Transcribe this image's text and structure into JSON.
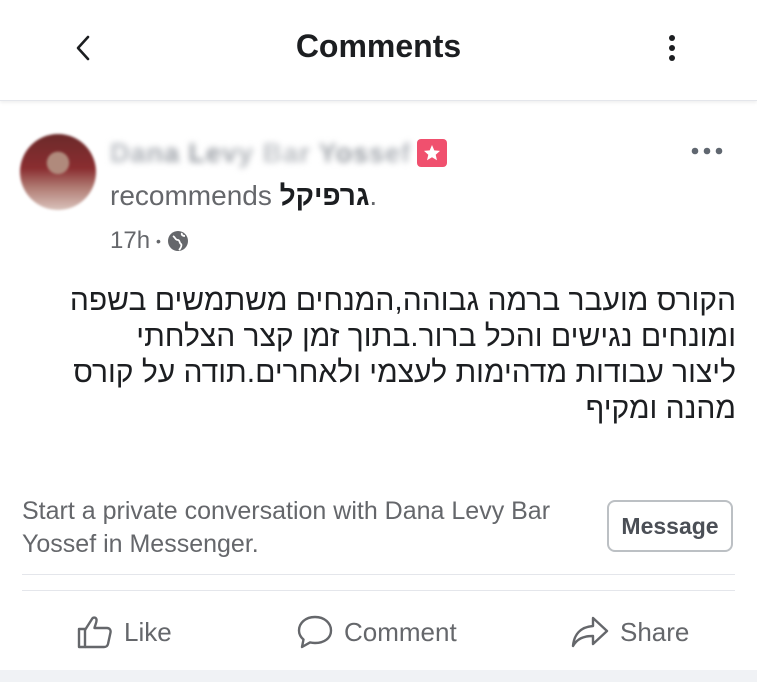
{
  "header": {
    "title": "Comments",
    "back_icon": "chevron-left-icon",
    "menu_icon": "kebab-vertical-icon"
  },
  "post": {
    "author_name": "Dana Levy Bar Yossef",
    "verb": "recommends",
    "page_name": "גרפיקל",
    "trailing_punct": ".",
    "time": "17h",
    "separator": "•",
    "audience_icon": "globe-icon",
    "badge_icon": "star-badge-icon",
    "badge_color": "#f0506e",
    "review_lines": [
      "הקורס מועבר ברמה גבוהה,המנחים משתמשים בשפה",
      "ומונחים נגישים והכל ברור.בתוך זמן קצר הצלחתי",
      "ליצור עבודות מדהימות לעצמי ולאחרים.תודה על קורס",
      "מהנה ומקיף"
    ]
  },
  "cta": {
    "text": "Start a private conversation with Dana Levy Bar Yossef in Messenger.",
    "button_label": "Message"
  },
  "actions": {
    "like_label": "Like",
    "comment_label": "Comment",
    "share_label": "Share"
  }
}
